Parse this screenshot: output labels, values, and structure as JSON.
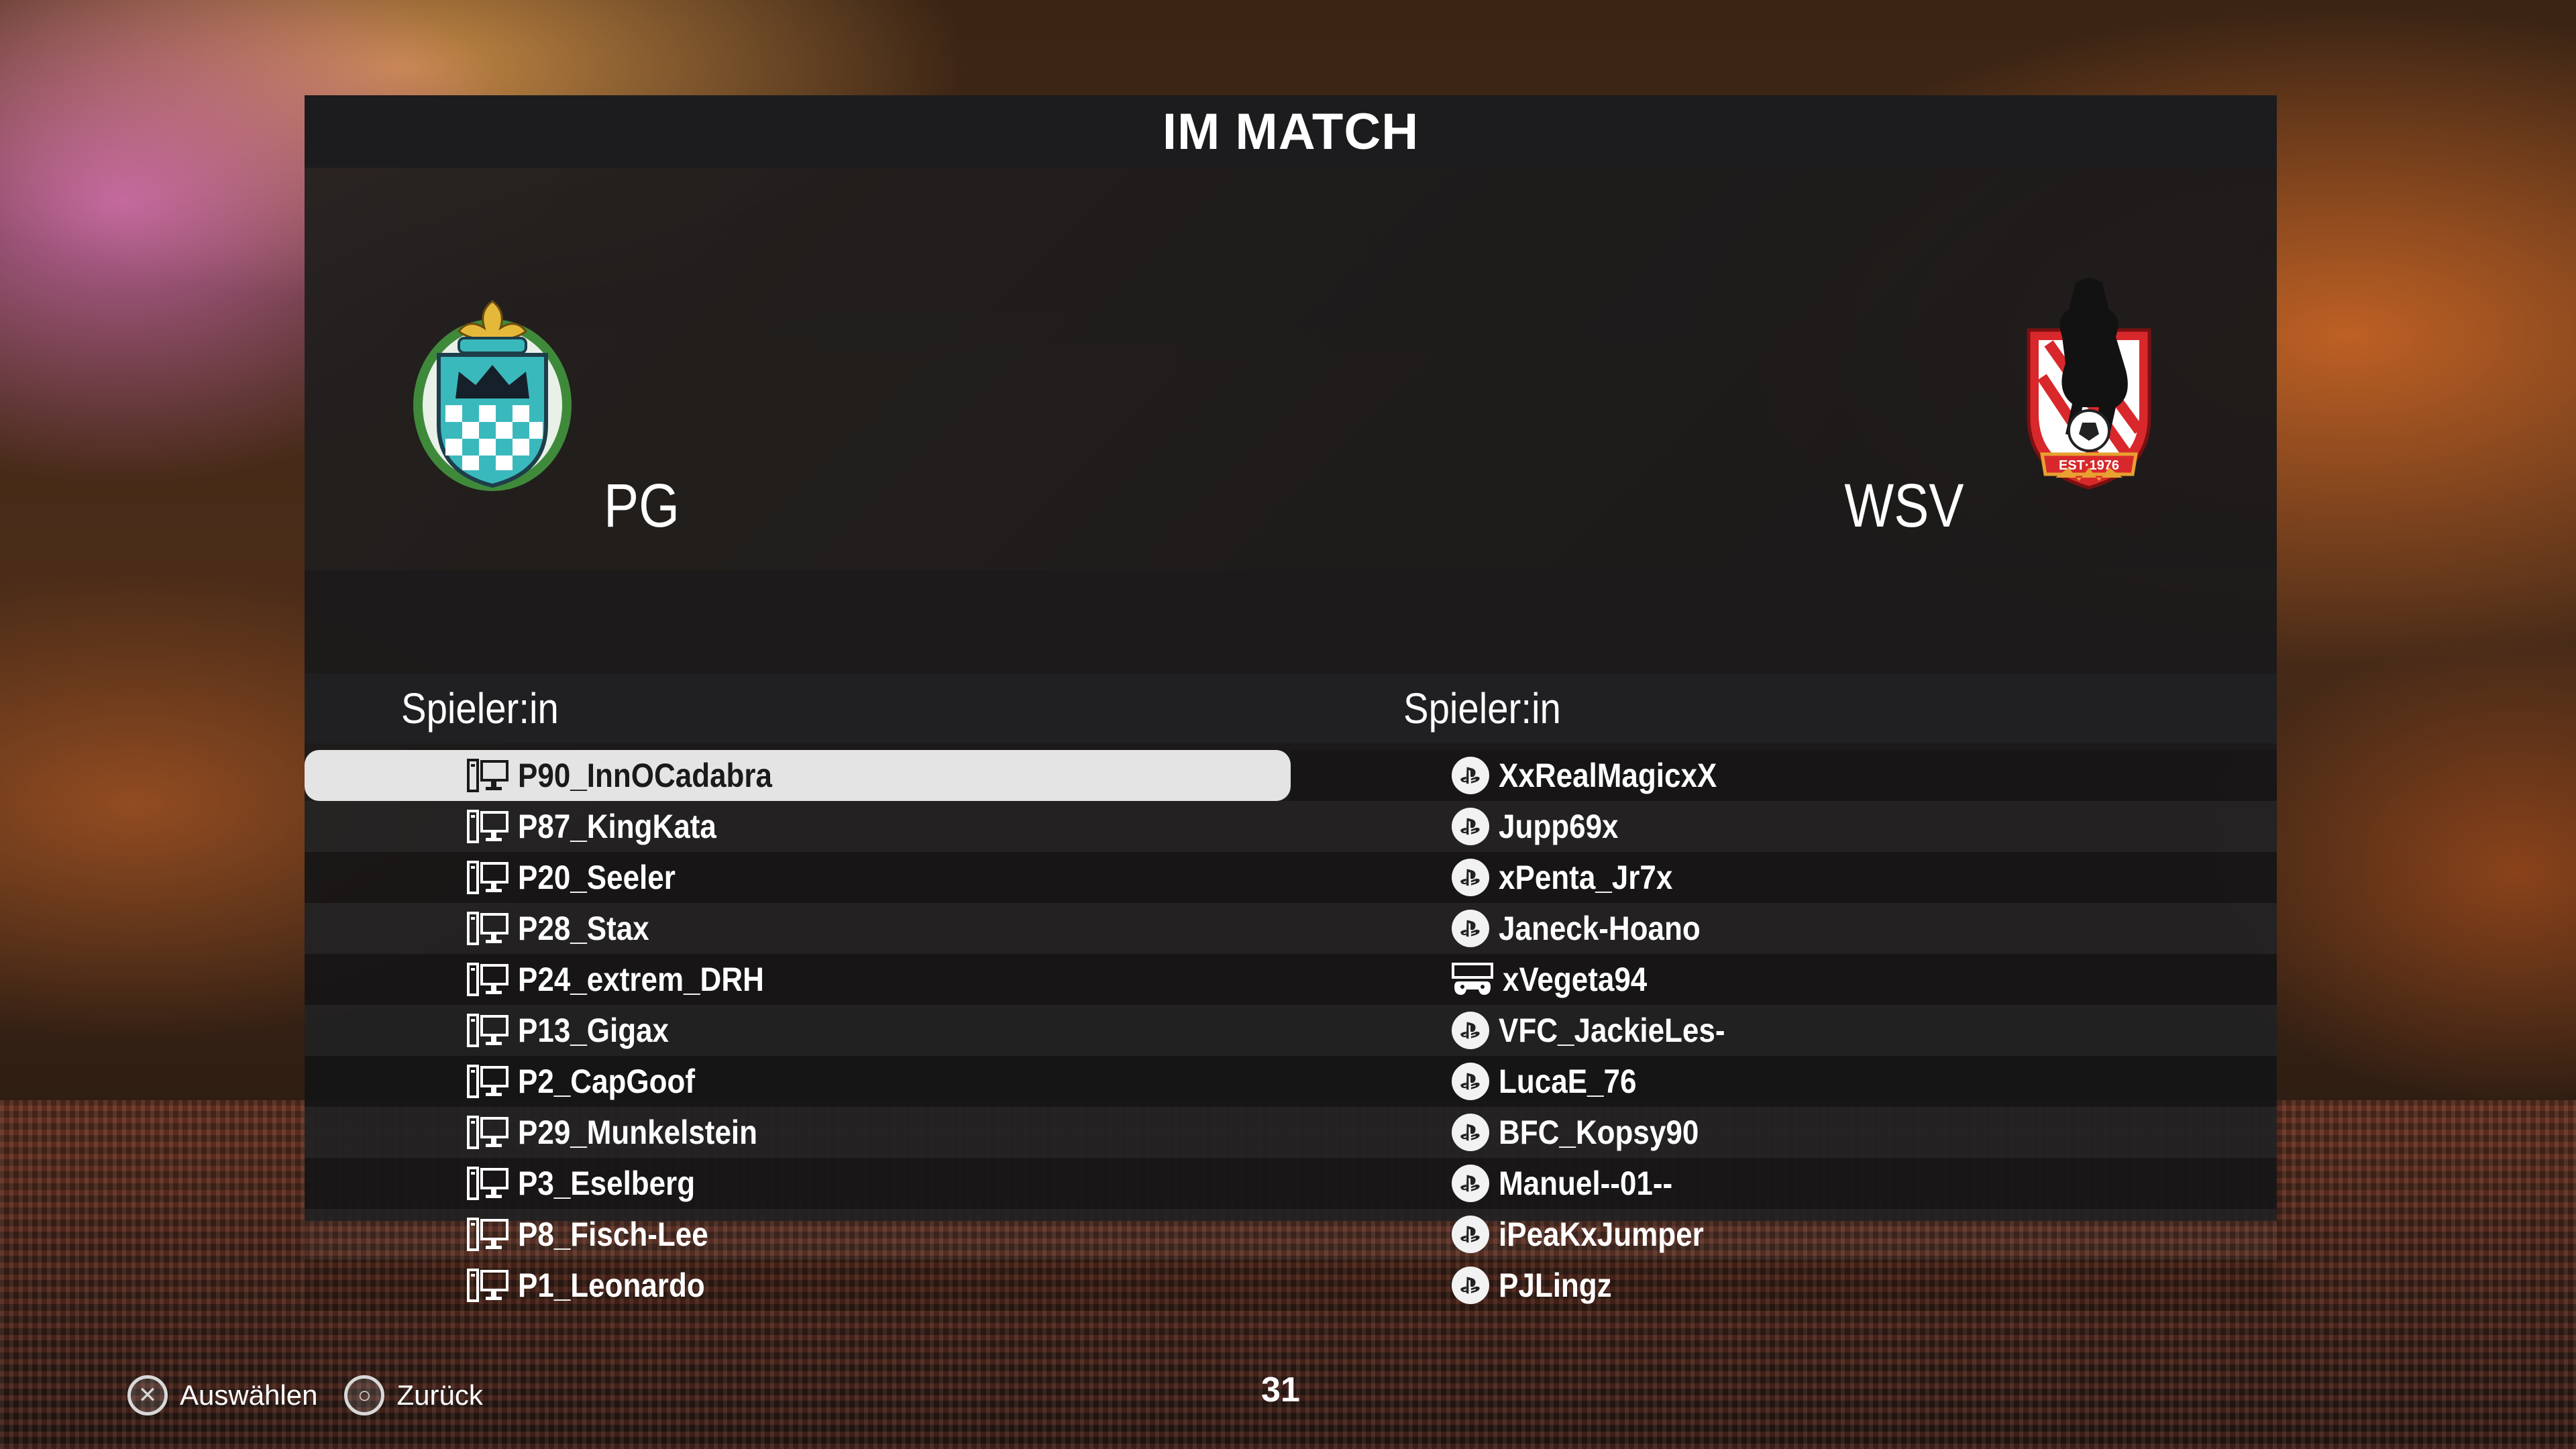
{
  "title": "IM MATCH",
  "home_team": {
    "name": "PG",
    "crest_icon": "green-crest-icon"
  },
  "away_team": {
    "name": "WSV",
    "crest_icon": "bear-crest-icon"
  },
  "home_column_header": "Spieler:in",
  "away_column_header": "Spieler:in",
  "home_players": [
    {
      "name": "P90_InnOCadabra",
      "platform": "pc-icon",
      "selected": true
    },
    {
      "name": "P87_KingKata",
      "platform": "pc-icon"
    },
    {
      "name": "P20_Seeler",
      "platform": "pc-icon"
    },
    {
      "name": "P28_Stax",
      "platform": "pc-icon"
    },
    {
      "name": "P24_extrem_DRH",
      "platform": "pc-icon"
    },
    {
      "name": "P13_Gigax",
      "platform": "pc-icon"
    },
    {
      "name": "P2_CapGoof",
      "platform": "pc-icon"
    },
    {
      "name": "P29_Munkelstein",
      "platform": "pc-icon"
    },
    {
      "name": "P3_Eselberg",
      "platform": "pc-icon"
    },
    {
      "name": "P8_Fisch-Lee",
      "platform": "pc-icon"
    },
    {
      "name": "P1_Leonardo",
      "platform": "pc-icon"
    }
  ],
  "away_players": [
    {
      "name": "XxRealMagicxX",
      "platform": "playstation-icon"
    },
    {
      "name": "Jupp69x",
      "platform": "playstation-icon"
    },
    {
      "name": "xPenta_Jr7x",
      "platform": "playstation-icon"
    },
    {
      "name": "Janeck-Hoano",
      "platform": "playstation-icon"
    },
    {
      "name": "xVegeta94",
      "platform": "controller-icon"
    },
    {
      "name": "VFC_JackieLes-",
      "platform": "playstation-icon"
    },
    {
      "name": "LucaE_76",
      "platform": "playstation-icon"
    },
    {
      "name": "BFC_Kopsy90",
      "platform": "playstation-icon"
    },
    {
      "name": "Manuel--01--",
      "platform": "playstation-icon"
    },
    {
      "name": "iPeaKxJumper",
      "platform": "playstation-icon"
    },
    {
      "name": "PJLingz",
      "platform": "playstation-icon"
    }
  ],
  "footer": {
    "select_label": "Auswählen",
    "back_label": "Zurück",
    "timer": "31"
  },
  "colors": {
    "panel": "#19191b",
    "selected_row": "#e4e4e4"
  }
}
